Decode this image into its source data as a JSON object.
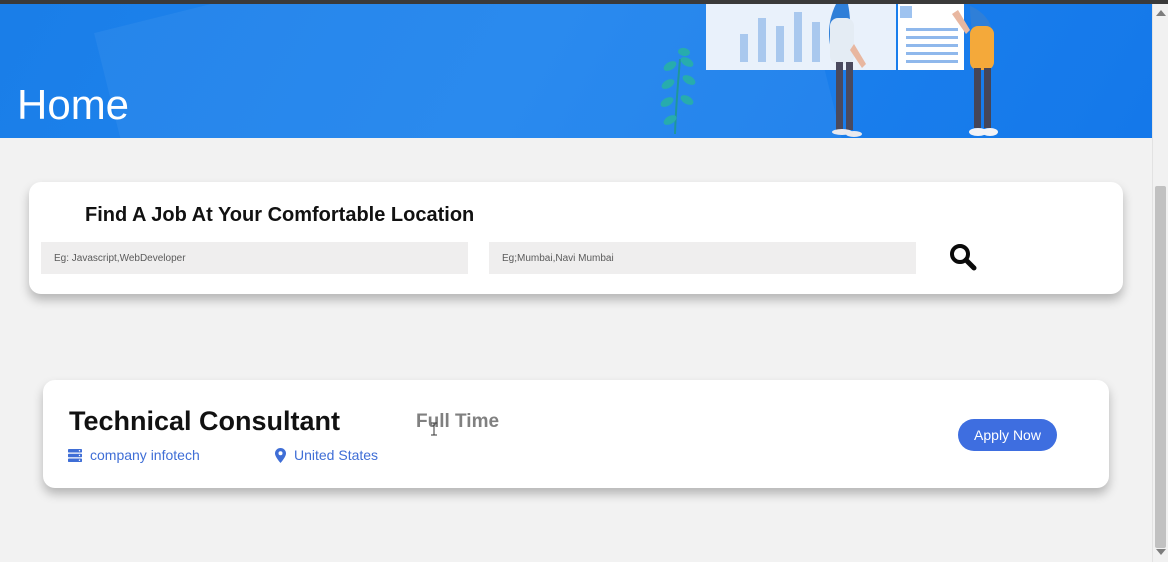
{
  "hero": {
    "title": "Home",
    "background_color": "#1a7ee8"
  },
  "search": {
    "heading": "Find A Job At Your Comfortable Location",
    "keyword_placeholder": "Eg: Javascript,WebDeveloper",
    "location_placeholder": "Eg;Mumbai,Navi Mumbai",
    "button_icon": "search-icon"
  },
  "job": {
    "title": "Technical Consultant",
    "type": "Full Time",
    "company": "company infotech",
    "company_icon": "server-icon",
    "location": "United States",
    "location_icon": "map-pin-icon",
    "apply_label": "Apply Now",
    "accent_color": "#3e6ee0"
  }
}
